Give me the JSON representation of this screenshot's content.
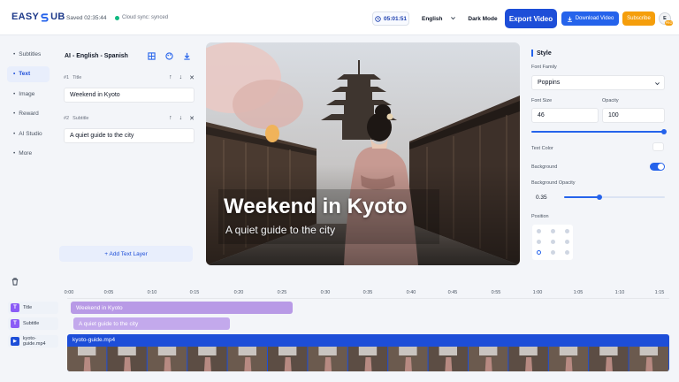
{
  "header": {
    "logo_left": "EASY",
    "logo_right": "UB",
    "saved": "Saved 02:35:44",
    "cloud": "Cloud sync: synced",
    "timer": "05:01:51",
    "language": "English",
    "dark_mode": "Dark Mode",
    "export": "Export Video",
    "download": "Download Video",
    "subscribe": "Subscribe",
    "avatar": "E",
    "avatar_badge": "PRO"
  },
  "nav": [
    {
      "label": "Subtitles"
    },
    {
      "label": "Text"
    },
    {
      "label": "Image"
    },
    {
      "label": "Reward"
    },
    {
      "label": "AI Studio"
    },
    {
      "label": "More"
    }
  ],
  "layers": {
    "title": "AI - English - Spanish",
    "items": [
      {
        "num": "#1",
        "type": "Title",
        "value": "Weekend in Kyoto"
      },
      {
        "num": "#2",
        "type": "Subtitle",
        "value": "A quiet guide to the city"
      }
    ],
    "add": "+ Add Text Layer"
  },
  "preview": {
    "title": "Weekend in Kyoto",
    "subtitle": "A quiet guide to the city"
  },
  "style": {
    "title": "Style",
    "font_family_label": "Font Family",
    "font_family": "Poppins",
    "font_size_label": "Font Size",
    "font_size": "46",
    "opacity_label": "Opacity",
    "opacity": "100",
    "opacity_level": 1.0,
    "text_color_label": "Text Color",
    "text_color": "#ffffff",
    "background_label": "Background",
    "background_on": true,
    "bg_opacity_label": "Background Opacity",
    "bg_opacity": "0.35",
    "bg_opacity_level": 0.35,
    "position_label": "Position",
    "position_selected": "bottom-left"
  },
  "timeline": {
    "ticks": [
      "0:00",
      "0:05",
      "0:10",
      "0:15",
      "0:20",
      "0:25",
      "0:30",
      "0:35",
      "0:40",
      "0:45",
      "0:55",
      "1:00",
      "1:05",
      "1:10",
      "1:15"
    ],
    "tracks": [
      {
        "badge": "T",
        "label": "Title",
        "clip": "Weekend in Kyoto",
        "color": "#b89ae6"
      },
      {
        "badge": "T",
        "label": "Subtitle",
        "clip": "A quiet guide to the city",
        "color": "#c3a9ec"
      },
      {
        "badge": "▶",
        "label": "kyoto-guide.mp4",
        "clip": "kyoto-guide.mp4",
        "color": "#1d4ed8"
      }
    ]
  },
  "colors": {
    "accent": "#1d4ed8",
    "subscribe": "#f59e0b",
    "text_badge": "#8b5cf6"
  }
}
